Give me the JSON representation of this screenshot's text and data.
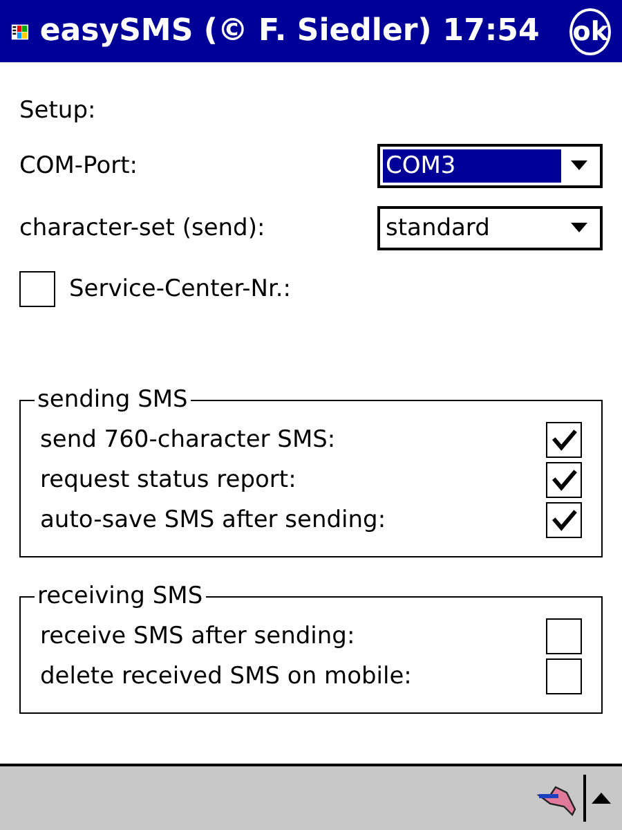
{
  "window": {
    "title": "easySMS (© F. Siedler)",
    "time": "17:54",
    "ok_button": "ok"
  },
  "setup": {
    "heading": "Setup:",
    "combos": [
      {
        "label": "COM-Port:",
        "value": "COM3",
        "focused": true
      },
      {
        "label": "character-set (send):",
        "value": "standard",
        "focused": false
      }
    ],
    "service_center": {
      "label": "Service-Center-Nr.:",
      "checked": false
    }
  },
  "groups": [
    {
      "title": "sending SMS",
      "items": [
        {
          "label": "send 760-character SMS:",
          "checked": true
        },
        {
          "label": "request status report:",
          "checked": true
        },
        {
          "label": "auto-save SMS after sending:",
          "checked": true
        }
      ]
    },
    {
      "title": "receiving SMS",
      "items": [
        {
          "label": "receive SMS after sending:",
          "checked": false
        },
        {
          "label": "delete received SMS on mobile:",
          "checked": false
        }
      ]
    }
  ]
}
